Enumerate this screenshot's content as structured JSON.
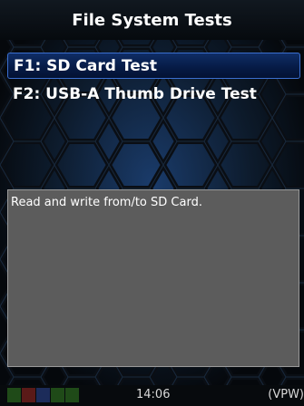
{
  "title": "File System Tests",
  "menu": {
    "items": [
      {
        "label": "F1: SD Card Test",
        "selected": true
      },
      {
        "label": "F2: USB-A Thumb Drive Test",
        "selected": false
      }
    ]
  },
  "description": "Read and write from/to SD Card.",
  "status": {
    "time": "14:06",
    "mode": "(VPW)",
    "indicators": [
      {
        "color": "#1f4a18"
      },
      {
        "color": "#5a1a18"
      },
      {
        "color": "#1c2c5a"
      },
      {
        "color": "#1f4a18"
      },
      {
        "color": "#1f4a18"
      }
    ]
  },
  "colors": {
    "accent": "#3b6fcf",
    "selected_bg": "#0a2355",
    "panel_bg": "#5c5c5c"
  }
}
